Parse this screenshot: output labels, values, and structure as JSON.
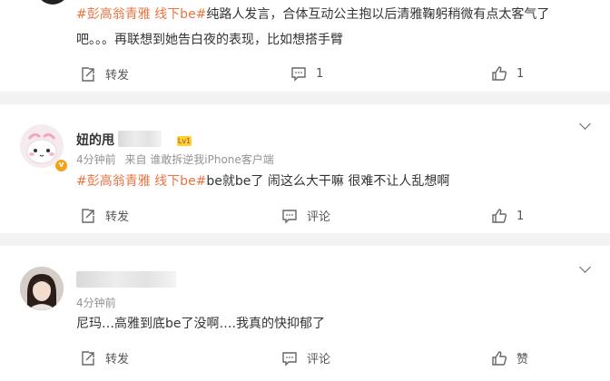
{
  "comment1": {
    "hashtag_text": "#彭高翁青雅 线下be#",
    "body_line1": "纯路人发言，合体互动公主抱以后清雅鞠躬稍微有点太客气了",
    "body_line2": "吧。。。再联想到她告白夜的表现，比如想搭手臂",
    "repost_label": "转发",
    "comment_count": "1",
    "like_count": "1"
  },
  "comment2": {
    "username_visible": "妞的甩",
    "level_badge": "Lv1",
    "time": "4分钟前",
    "source": "来自 谁敢拆逆我iPhone客户端",
    "hashtag_text": "#彭高翁青雅 线下be#",
    "body": "be就be了 闹这么大干嘛 很难不让人乱想啊",
    "repost_label": "转发",
    "comment_label": "评论",
    "like_count": "1"
  },
  "comment3": {
    "time": "4分钟前",
    "body": "尼玛…高雅到底be了没啊….我真的快抑郁了",
    "repost_label": "转发",
    "comment_label": "评论",
    "like_label": "赞"
  },
  "colors": {
    "hashtag": "#eb7340",
    "meta": "#939393",
    "page_bg": "#f2f2f2",
    "vip_badge": "#f3a21b"
  },
  "icons": [
    "repost-icon",
    "comment-icon",
    "like-icon",
    "chevron-down-icon",
    "verified-badge-icon"
  ]
}
